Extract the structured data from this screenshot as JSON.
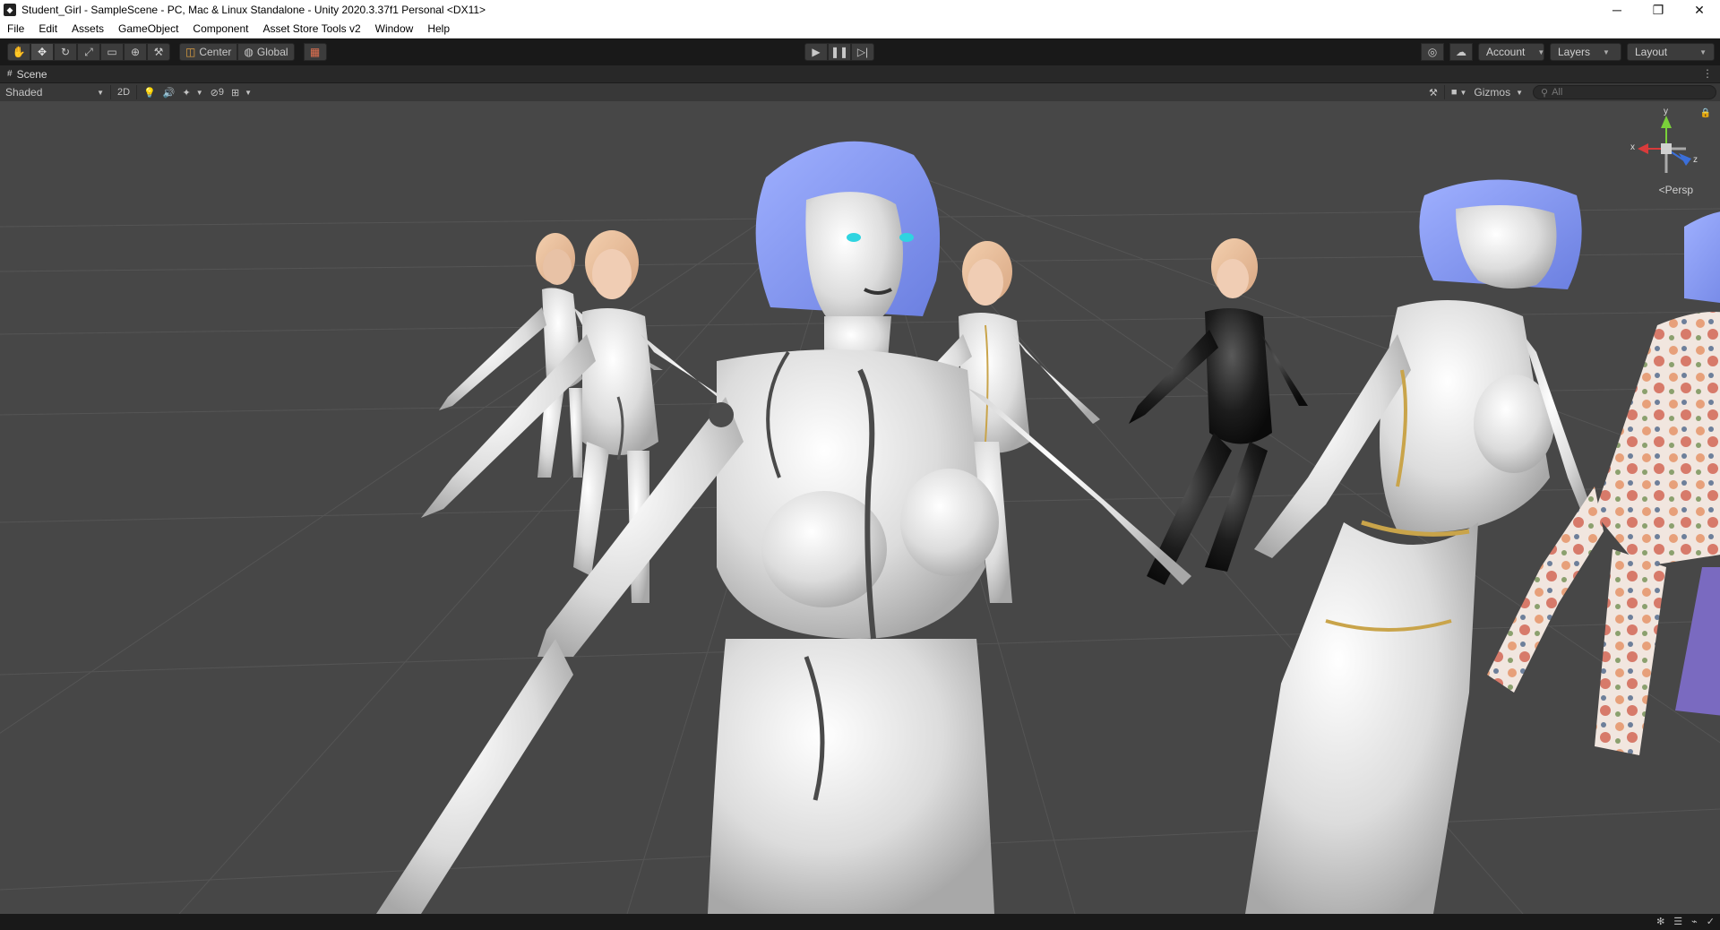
{
  "window": {
    "title": "Student_Girl - SampleScene - PC, Mac & Linux Standalone - Unity 2020.3.37f1 Personal <DX11>",
    "minimize": "─",
    "maximize": "❐",
    "close": "✕"
  },
  "menu": [
    "File",
    "Edit",
    "Assets",
    "GameObject",
    "Component",
    "Asset Store Tools v2",
    "Window",
    "Help"
  ],
  "toolbar": {
    "pivot_label": "Center",
    "space_label": "Global",
    "account_label": "Account",
    "layers_label": "Layers",
    "layout_label": "Layout"
  },
  "scene": {
    "tab_label": "Scene",
    "draw_mode": "Shaded",
    "mode_2d": "2D",
    "hidden_count": "9",
    "gizmos_label": "Gizmos",
    "search_placeholder": "All",
    "projection_label": "Persp",
    "axis_x": "x",
    "axis_y": "y",
    "axis_z": "z"
  },
  "colors": {
    "viewport_bg": "#474747",
    "toolbar_bg": "#191919",
    "axis_x": "#d93b3b",
    "axis_y": "#7ad13a",
    "axis_z": "#3b6fd9"
  }
}
